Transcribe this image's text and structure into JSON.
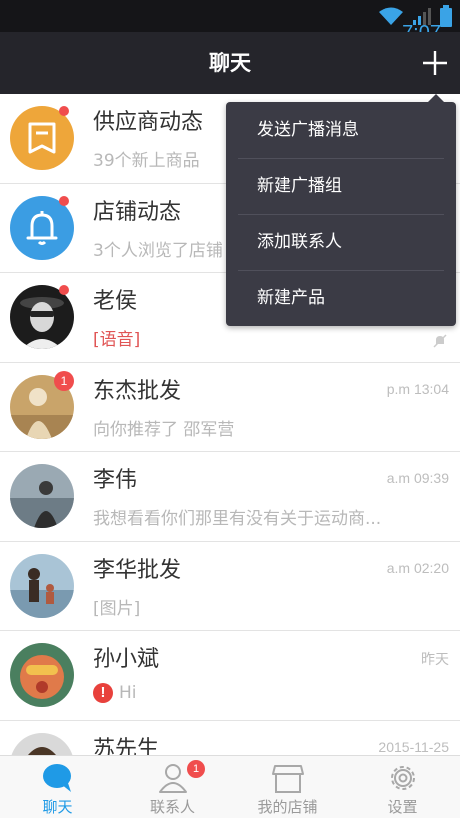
{
  "status": {
    "time": "7:07"
  },
  "header": {
    "title": "聊天"
  },
  "menu": [
    "发送广播消息",
    "新建广播组",
    "添加联系人",
    "新建产品"
  ],
  "chats": [
    {
      "name": "供应商动态",
      "preview": "39个新上商品",
      "time": "",
      "badge": ""
    },
    {
      "name": "店铺动态",
      "preview": "3个人浏览了店铺",
      "time": "",
      "badge": ""
    },
    {
      "name": "老侯",
      "preview": "[语音]",
      "time": "",
      "badge": ""
    },
    {
      "name": "东杰批发",
      "preview": "向你推荐了 邵军营",
      "time": "p.m 13:04",
      "badge": "1"
    },
    {
      "name": "李伟",
      "preview": "我想看看你们那里有没有关于运动商...",
      "time": "a.m 09:39",
      "badge": ""
    },
    {
      "name": "李华批发",
      "preview": "[图片]",
      "time": "a.m 02:20",
      "badge": ""
    },
    {
      "name": "孙小斌",
      "preview": "Hi",
      "time": "昨天",
      "badge": ""
    },
    {
      "name": "苏先生",
      "preview": "",
      "time": "2015-11-25",
      "badge": ""
    }
  ],
  "tabs": [
    {
      "label": "聊天",
      "badge": ""
    },
    {
      "label": "联系人",
      "badge": "1"
    },
    {
      "label": "我的店铺",
      "badge": ""
    },
    {
      "label": "设置",
      "badge": ""
    }
  ],
  "colors": {
    "accent": "#1f9ae6",
    "badge": "#f04d4d",
    "navbar": "#25252b",
    "menu": "#3b3b45"
  }
}
